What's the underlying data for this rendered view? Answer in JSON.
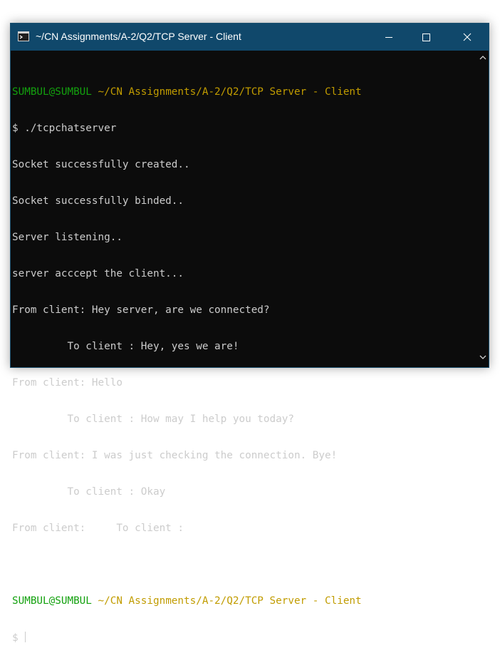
{
  "window": {
    "title": "~/CN Assignments/A-2/Q2/TCP Server - Client",
    "icon": "terminal-icon",
    "controls": {
      "minimize_icon": "minimize-icon",
      "maximize_icon": "maximize-icon",
      "close_icon": "close-icon"
    }
  },
  "colors": {
    "titlebar": "#10486b",
    "terminal_bg": "#0c0c0c",
    "text": "#cccccc",
    "prompt_user": "#13a10e",
    "prompt_path": "#c19c00"
  },
  "terminal": {
    "prompt1": {
      "user": "SUMBUL@SUMBUL",
      "path": "~/CN Assignments/A-2/Q2/TCP Server - Client"
    },
    "command": "$ ./tcpchatserver",
    "output": [
      "Socket successfully created..",
      "Socket successfully binded..",
      "Server listening..",
      "server acccept the client...",
      "From client: Hey server, are we connected?",
      "         To client : Hey, yes we are!",
      "From client: Hello",
      "         To client : How may I help you today?",
      "From client: I was just checking the connection. Bye!",
      "         To client : Okay",
      "From client:     To client :"
    ],
    "prompt2": {
      "user": "SUMBUL@SUMBUL",
      "path": "~/CN Assignments/A-2/Q2/TCP Server - Client"
    },
    "input_prompt": "$ "
  }
}
